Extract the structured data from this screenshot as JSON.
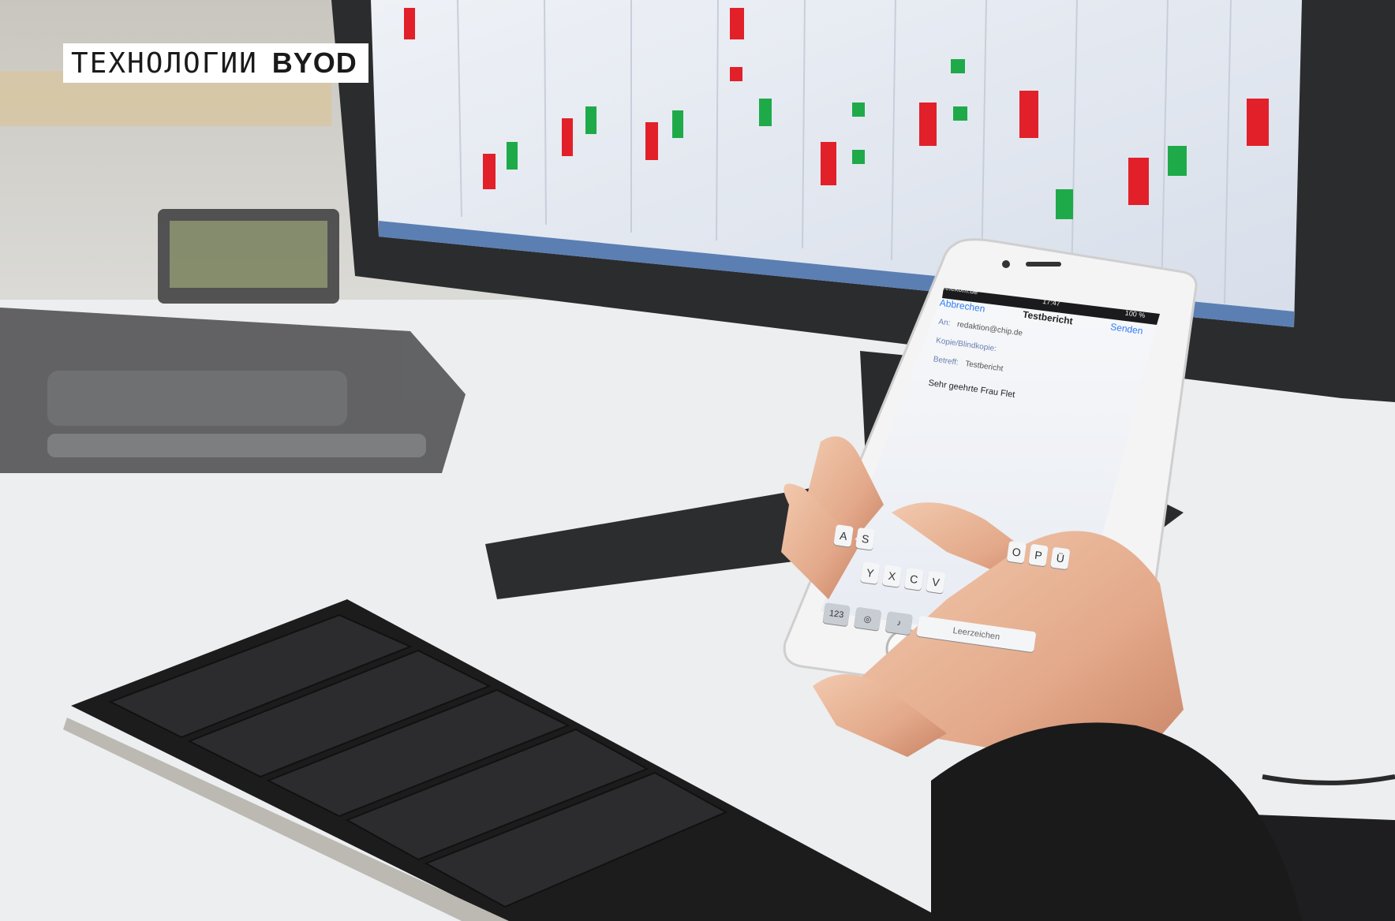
{
  "header": {
    "text": "ТЕХНОЛОГИИ",
    "tag": "BYOD"
  },
  "phone": {
    "status": {
      "carrier": "Telekom.de",
      "time": "17:47",
      "battery": "100 %"
    },
    "nav": {
      "cancel": "Abbrechen",
      "title": "Testbericht",
      "send": "Senden"
    },
    "to_label": "An:",
    "to_value": "redaktion@chip.de",
    "cc_label": "Kopie/Blindkopie:",
    "subject_label": "Betreff:",
    "subject_value": "Testbericht",
    "body": "Sehr geehrte Frau Flet",
    "keyboard": {
      "row2": [
        "A",
        "S"
      ],
      "row2_right": [
        "O",
        "P",
        "Ü"
      ],
      "row3": [
        "Y",
        "X",
        "C",
        "V"
      ],
      "numbers": "123",
      "space": "Leerzeichen"
    }
  },
  "colors": {
    "accent_red": "#e2202a",
    "accent_green": "#1faa4a",
    "screen_blue": "#dfe7f4"
  }
}
